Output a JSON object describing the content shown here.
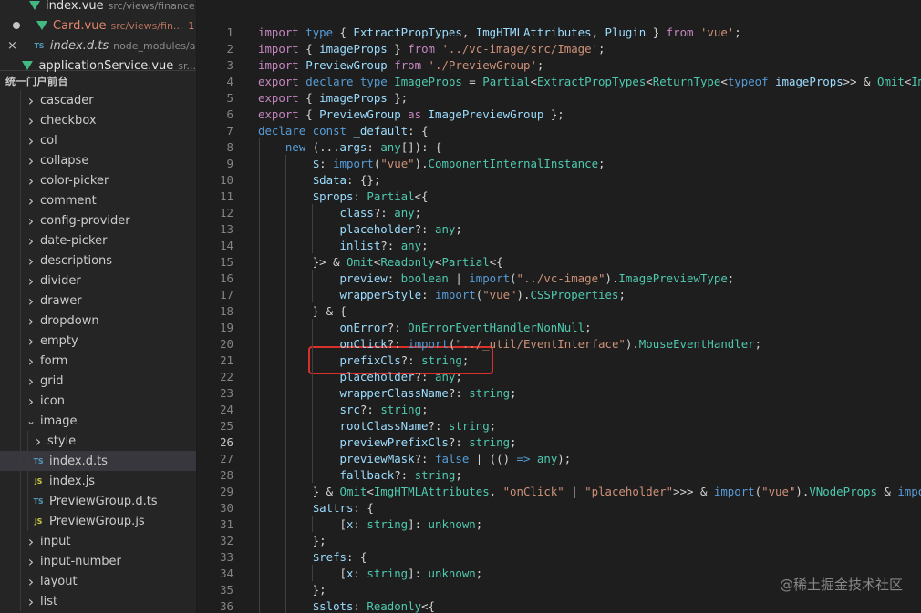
{
  "open_editors": [
    {
      "lead": "none",
      "icon": "vue",
      "name": "index.vue",
      "path": "src/views/finance",
      "modified": false,
      "italic": false,
      "badge": ""
    },
    {
      "lead": "dot",
      "icon": "vue",
      "name": "Card.vue",
      "path": "src/views/fin...",
      "modified": true,
      "italic": false,
      "badge": "1"
    },
    {
      "lead": "close",
      "icon": "ts",
      "name": "index.d.ts",
      "path": "node_modules/a...",
      "modified": false,
      "italic": true,
      "badge": ""
    },
    {
      "lead": "none",
      "icon": "vue",
      "name": "applicationService.vue",
      "path": "sr...",
      "modified": false,
      "italic": false,
      "badge": ""
    }
  ],
  "icons": {
    "close": "×",
    "ts": "TS",
    "js": "JS",
    "chevron_right": "›",
    "chevron_down": "⌄"
  },
  "explorer": {
    "section_title": "统一门户前台",
    "items": [
      {
        "label": "cascader",
        "type": "folder",
        "depth": 1,
        "expanded": false
      },
      {
        "label": "checkbox",
        "type": "folder",
        "depth": 1,
        "expanded": false
      },
      {
        "label": "col",
        "type": "folder",
        "depth": 1,
        "expanded": false
      },
      {
        "label": "collapse",
        "type": "folder",
        "depth": 1,
        "expanded": false
      },
      {
        "label": "color-picker",
        "type": "folder",
        "depth": 1,
        "expanded": false
      },
      {
        "label": "comment",
        "type": "folder",
        "depth": 1,
        "expanded": false
      },
      {
        "label": "config-provider",
        "type": "folder",
        "depth": 1,
        "expanded": false
      },
      {
        "label": "date-picker",
        "type": "folder",
        "depth": 1,
        "expanded": false
      },
      {
        "label": "descriptions",
        "type": "folder",
        "depth": 1,
        "expanded": false
      },
      {
        "label": "divider",
        "type": "folder",
        "depth": 1,
        "expanded": false
      },
      {
        "label": "drawer",
        "type": "folder",
        "depth": 1,
        "expanded": false
      },
      {
        "label": "dropdown",
        "type": "folder",
        "depth": 1,
        "expanded": false
      },
      {
        "label": "empty",
        "type": "folder",
        "depth": 1,
        "expanded": false
      },
      {
        "label": "form",
        "type": "folder",
        "depth": 1,
        "expanded": false
      },
      {
        "label": "grid",
        "type": "folder",
        "depth": 1,
        "expanded": false
      },
      {
        "label": "icon",
        "type": "folder",
        "depth": 1,
        "expanded": false
      },
      {
        "label": "image",
        "type": "folder",
        "depth": 1,
        "expanded": true
      },
      {
        "label": "style",
        "type": "folder",
        "depth": 2,
        "expanded": false
      },
      {
        "label": "index.d.ts",
        "type": "ts",
        "depth": 2,
        "selected": true
      },
      {
        "label": "index.js",
        "type": "js",
        "depth": 2
      },
      {
        "label": "PreviewGroup.d.ts",
        "type": "ts",
        "depth": 2
      },
      {
        "label": "PreviewGroup.js",
        "type": "js",
        "depth": 2
      },
      {
        "label": "input",
        "type": "folder",
        "depth": 1,
        "expanded": false
      },
      {
        "label": "input-number",
        "type": "folder",
        "depth": 1,
        "expanded": false
      },
      {
        "label": "layout",
        "type": "folder",
        "depth": 1,
        "expanded": false
      },
      {
        "label": "list",
        "type": "folder",
        "depth": 1,
        "expanded": false
      }
    ]
  },
  "editor": {
    "current_line": 26,
    "lines": [
      [
        [
          "import",
          "ctl"
        ],
        [
          " ",
          "p"
        ],
        [
          "type",
          "kw"
        ],
        [
          " { ",
          "p"
        ],
        [
          "ExtractPropTypes",
          "var"
        ],
        [
          ", ",
          "p"
        ],
        [
          "ImgHTMLAttributes",
          "var"
        ],
        [
          ", ",
          "p"
        ],
        [
          "Plugin",
          "var"
        ],
        [
          " } ",
          "p"
        ],
        [
          "from",
          "ctl"
        ],
        [
          " ",
          "p"
        ],
        [
          "'vue'",
          "str"
        ],
        [
          ";",
          "p"
        ]
      ],
      [
        [
          "import",
          "ctl"
        ],
        [
          " { ",
          "p"
        ],
        [
          "imageProps",
          "var"
        ],
        [
          " } ",
          "p"
        ],
        [
          "from",
          "ctl"
        ],
        [
          " ",
          "p"
        ],
        [
          "'../vc-image/src/Image'",
          "str"
        ],
        [
          ";",
          "p"
        ]
      ],
      [
        [
          "import",
          "ctl"
        ],
        [
          " ",
          "p"
        ],
        [
          "PreviewGroup",
          "var"
        ],
        [
          " ",
          "p"
        ],
        [
          "from",
          "ctl"
        ],
        [
          " ",
          "p"
        ],
        [
          "'./PreviewGroup'",
          "str"
        ],
        [
          ";",
          "p"
        ]
      ],
      [
        [
          "export",
          "ctl"
        ],
        [
          " ",
          "p"
        ],
        [
          "declare",
          "kw"
        ],
        [
          " ",
          "p"
        ],
        [
          "type",
          "kw"
        ],
        [
          " ",
          "p"
        ],
        [
          "ImageProps",
          "type"
        ],
        [
          " = ",
          "p"
        ],
        [
          "Partial",
          "type"
        ],
        [
          "<",
          "p"
        ],
        [
          "ExtractPropTypes",
          "type"
        ],
        [
          "<",
          "p"
        ],
        [
          "ReturnType",
          "type"
        ],
        [
          "<",
          "p"
        ],
        [
          "typeof",
          "kw"
        ],
        [
          " ",
          "p"
        ],
        [
          "imageProps",
          "var"
        ],
        [
          ">> & ",
          "p"
        ],
        [
          "Omit",
          "type"
        ],
        [
          "<",
          "p"
        ],
        [
          "ImgHTMLAttribu",
          "type"
        ]
      ],
      [
        [
          "export",
          "ctl"
        ],
        [
          " { ",
          "p"
        ],
        [
          "imageProps",
          "var"
        ],
        [
          " };",
          "p"
        ]
      ],
      [
        [
          "export",
          "ctl"
        ],
        [
          " { ",
          "p"
        ],
        [
          "PreviewGroup",
          "var"
        ],
        [
          " ",
          "p"
        ],
        [
          "as",
          "ctl"
        ],
        [
          " ",
          "p"
        ],
        [
          "ImagePreviewGroup",
          "var"
        ],
        [
          " };",
          "p"
        ]
      ],
      [
        [
          "declare",
          "kw"
        ],
        [
          " ",
          "p"
        ],
        [
          "const",
          "kw"
        ],
        [
          " ",
          "p"
        ],
        [
          "_default",
          "var"
        ],
        [
          ": {",
          "p"
        ]
      ],
      [
        [
          "    ",
          "p"
        ],
        [
          "new",
          "kw"
        ],
        [
          " (...",
          "p"
        ],
        [
          "args",
          "var"
        ],
        [
          ": ",
          "p"
        ],
        [
          "any",
          "type"
        ],
        [
          "[]): {",
          "p"
        ]
      ],
      [
        [
          "        ",
          "p"
        ],
        [
          "$",
          "var"
        ],
        [
          ": ",
          "p"
        ],
        [
          "import",
          "kw"
        ],
        [
          "(",
          "p"
        ],
        [
          "\"vue\"",
          "str"
        ],
        [
          ").",
          "p"
        ],
        [
          "ComponentInternalInstance",
          "type"
        ],
        [
          ";",
          "p"
        ]
      ],
      [
        [
          "        ",
          "p"
        ],
        [
          "$data",
          "var"
        ],
        [
          ": {};",
          "p"
        ]
      ],
      [
        [
          "        ",
          "p"
        ],
        [
          "$props",
          "var"
        ],
        [
          ": ",
          "p"
        ],
        [
          "Partial",
          "type"
        ],
        [
          "<{",
          "p"
        ]
      ],
      [
        [
          "            ",
          "p"
        ],
        [
          "class",
          "var"
        ],
        [
          "?: ",
          "p"
        ],
        [
          "any",
          "type"
        ],
        [
          ";",
          "p"
        ]
      ],
      [
        [
          "            ",
          "p"
        ],
        [
          "placeholder",
          "var"
        ],
        [
          "?: ",
          "p"
        ],
        [
          "any",
          "type"
        ],
        [
          ";",
          "p"
        ]
      ],
      [
        [
          "            ",
          "p"
        ],
        [
          "inlist",
          "var"
        ],
        [
          "?: ",
          "p"
        ],
        [
          "any",
          "type"
        ],
        [
          ";",
          "p"
        ]
      ],
      [
        [
          "        ",
          "p"
        ],
        [
          "}> & ",
          "p"
        ],
        [
          "Omit",
          "type"
        ],
        [
          "<",
          "p"
        ],
        [
          "Readonly",
          "type"
        ],
        [
          "<",
          "p"
        ],
        [
          "Partial",
          "type"
        ],
        [
          "<{",
          "p"
        ]
      ],
      [
        [
          "            ",
          "p"
        ],
        [
          "preview",
          "var"
        ],
        [
          ": ",
          "p"
        ],
        [
          "boolean",
          "type"
        ],
        [
          " | ",
          "p"
        ],
        [
          "import",
          "kw"
        ],
        [
          "(",
          "p"
        ],
        [
          "\"../vc-image\"",
          "str"
        ],
        [
          ").",
          "p"
        ],
        [
          "ImagePreviewType",
          "type"
        ],
        [
          ";",
          "p"
        ]
      ],
      [
        [
          "            ",
          "p"
        ],
        [
          "wrapperStyle",
          "var"
        ],
        [
          ": ",
          "p"
        ],
        [
          "import",
          "kw"
        ],
        [
          "(",
          "p"
        ],
        [
          "\"vue\"",
          "str"
        ],
        [
          ").",
          "p"
        ],
        [
          "CSSProperties",
          "type"
        ],
        [
          ";",
          "p"
        ]
      ],
      [
        [
          "        ",
          "p"
        ],
        [
          "} & {",
          "p"
        ]
      ],
      [
        [
          "            ",
          "p"
        ],
        [
          "onError",
          "var"
        ],
        [
          "?: ",
          "p"
        ],
        [
          "OnErrorEventHandlerNonNull",
          "type"
        ],
        [
          ";",
          "p"
        ]
      ],
      [
        [
          "            ",
          "p"
        ],
        [
          "onClick",
          "var"
        ],
        [
          "?: ",
          "p"
        ],
        [
          "import",
          "kw"
        ],
        [
          "(",
          "p"
        ],
        [
          "\"../_util/EventInterface\"",
          "str"
        ],
        [
          ").",
          "p"
        ],
        [
          "MouseEventHandler",
          "type"
        ],
        [
          ";",
          "p"
        ]
      ],
      [
        [
          "            ",
          "p"
        ],
        [
          "prefixCls",
          "var"
        ],
        [
          "?: ",
          "p"
        ],
        [
          "string",
          "type"
        ],
        [
          ";",
          "p"
        ]
      ],
      [
        [
          "            ",
          "p"
        ],
        [
          "placeholder",
          "var"
        ],
        [
          "?: ",
          "p"
        ],
        [
          "any",
          "type"
        ],
        [
          ";",
          "p"
        ]
      ],
      [
        [
          "            ",
          "p"
        ],
        [
          "wrapperClassName",
          "var"
        ],
        [
          "?: ",
          "p"
        ],
        [
          "string",
          "type"
        ],
        [
          ";",
          "p"
        ]
      ],
      [
        [
          "            ",
          "p"
        ],
        [
          "src",
          "var"
        ],
        [
          "?: ",
          "p"
        ],
        [
          "string",
          "type"
        ],
        [
          ";",
          "p"
        ]
      ],
      [
        [
          "            ",
          "p"
        ],
        [
          "rootClassName",
          "var"
        ],
        [
          "?: ",
          "p"
        ],
        [
          "string",
          "type"
        ],
        [
          ";",
          "p"
        ]
      ],
      [
        [
          "            ",
          "p"
        ],
        [
          "previewPrefixCls",
          "var"
        ],
        [
          "?: ",
          "p"
        ],
        [
          "string",
          "type"
        ],
        [
          ";",
          "p"
        ]
      ],
      [
        [
          "            ",
          "p"
        ],
        [
          "previewMask",
          "var"
        ],
        [
          "?: ",
          "p"
        ],
        [
          "false",
          "kw"
        ],
        [
          " | (() ",
          "p"
        ],
        [
          "=>",
          "kw"
        ],
        [
          " ",
          "p"
        ],
        [
          "any",
          "type"
        ],
        [
          ");",
          "p"
        ]
      ],
      [
        [
          "            ",
          "p"
        ],
        [
          "fallback",
          "var"
        ],
        [
          "?: ",
          "p"
        ],
        [
          "string",
          "type"
        ],
        [
          ";",
          "p"
        ]
      ],
      [
        [
          "        ",
          "p"
        ],
        [
          "} & ",
          "p"
        ],
        [
          "Omit",
          "type"
        ],
        [
          "<",
          "p"
        ],
        [
          "ImgHTMLAttributes",
          "type"
        ],
        [
          ", ",
          "p"
        ],
        [
          "\"onClick\"",
          "str"
        ],
        [
          " | ",
          "p"
        ],
        [
          "\"placeholder\"",
          "str"
        ],
        [
          ">>> & ",
          "p"
        ],
        [
          "import",
          "kw"
        ],
        [
          "(",
          "p"
        ],
        [
          "\"vue\"",
          "str"
        ],
        [
          ").",
          "p"
        ],
        [
          "VNodeProps",
          "type"
        ],
        [
          " & ",
          "p"
        ],
        [
          "import",
          "kw"
        ],
        [
          "(",
          "p"
        ]
      ],
      [
        [
          "        ",
          "p"
        ],
        [
          "$attrs",
          "var"
        ],
        [
          ": {",
          "p"
        ]
      ],
      [
        [
          "            [",
          "p"
        ],
        [
          "x",
          "var"
        ],
        [
          ": ",
          "p"
        ],
        [
          "string",
          "type"
        ],
        [
          "]: ",
          "p"
        ],
        [
          "unknown",
          "type"
        ],
        [
          ";",
          "p"
        ]
      ],
      [
        [
          "        };",
          "p"
        ]
      ],
      [
        [
          "        ",
          "p"
        ],
        [
          "$refs",
          "var"
        ],
        [
          ": {",
          "p"
        ]
      ],
      [
        [
          "            [",
          "p"
        ],
        [
          "x",
          "var"
        ],
        [
          ": ",
          "p"
        ],
        [
          "string",
          "type"
        ],
        [
          "]: ",
          "p"
        ],
        [
          "unknown",
          "type"
        ],
        [
          ";",
          "p"
        ]
      ],
      [
        [
          "        };",
          "p"
        ]
      ],
      [
        [
          "        ",
          "p"
        ],
        [
          "$slots",
          "var"
        ],
        [
          ": ",
          "p"
        ],
        [
          "Readonly",
          "type"
        ],
        [
          "<{",
          "p"
        ]
      ]
    ]
  },
  "watermark": "@稀土掘金技术社区"
}
